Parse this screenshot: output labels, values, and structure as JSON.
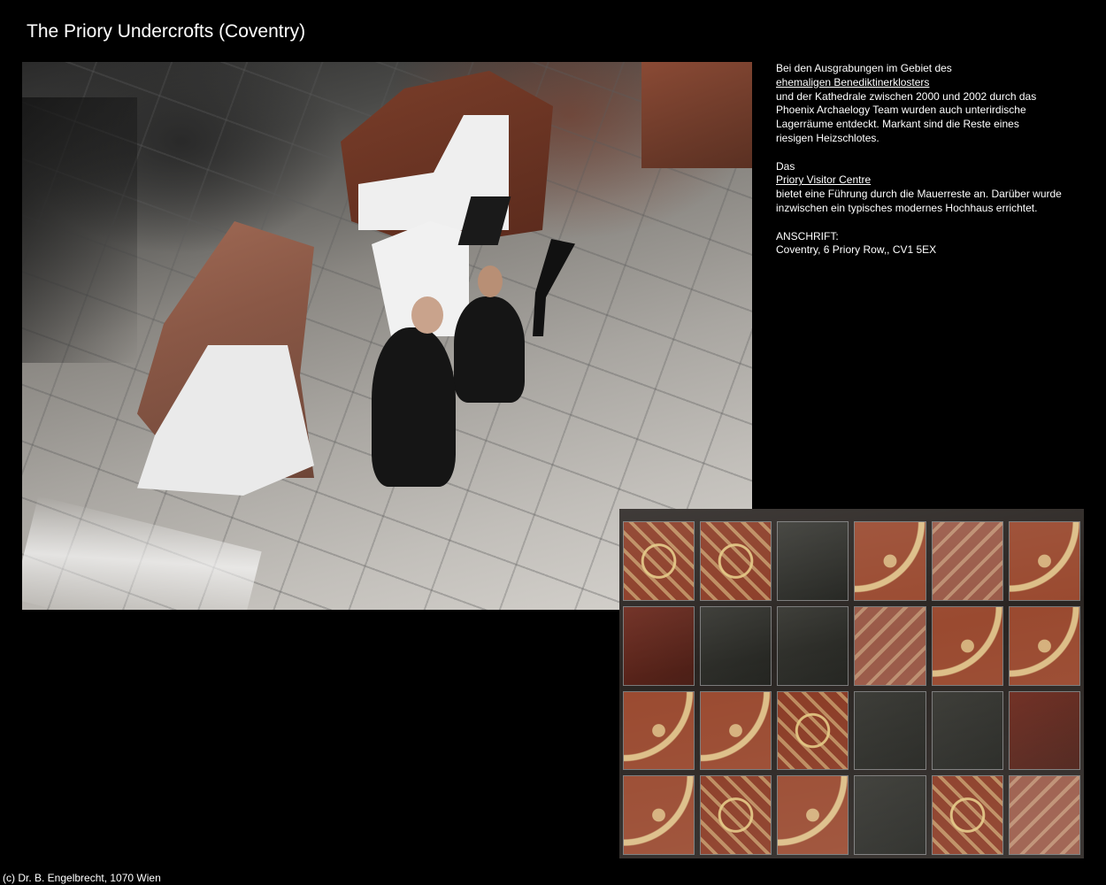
{
  "page": {
    "title": "The Priory Undercrofts (Coventry)",
    "footer": "(c) Dr. B. Engelbrecht, 1070 Wien",
    "background_color": "#000000",
    "text_color": "#ffffff"
  },
  "description": {
    "p1": {
      "line1": "Bei den Ausgrabungen im Gebiet des",
      "link1": "ehemaligen Benediktinerklosters",
      "line2": "und der Kathedrale zwischen 2000 und 2002 durch das",
      "line3": "Phoenix Archaelogy Team wurden auch unterirdische",
      "line4": "Lagerräume entdeckt. Markant sind die Reste eines",
      "line5": "riesigen Heizschlotes."
    },
    "p2": {
      "line1": "Das",
      "link1": "Priory Visitor Centre ",
      "line2": "bietet eine Führung durch die Mauerreste an. Darüber wurde",
      "line3": "inzwischen ein typisches modernes Hochhaus errichtet."
    },
    "p3": {
      "label": "ANSCHRIFT:",
      "address": "Coventry, 6 Priory Row,, CV1 5EX"
    }
  },
  "photos": {
    "main": "photo-excavated-undercroft-with-monk-figures",
    "tiles": "photo-medieval-floor-tiles"
  }
}
